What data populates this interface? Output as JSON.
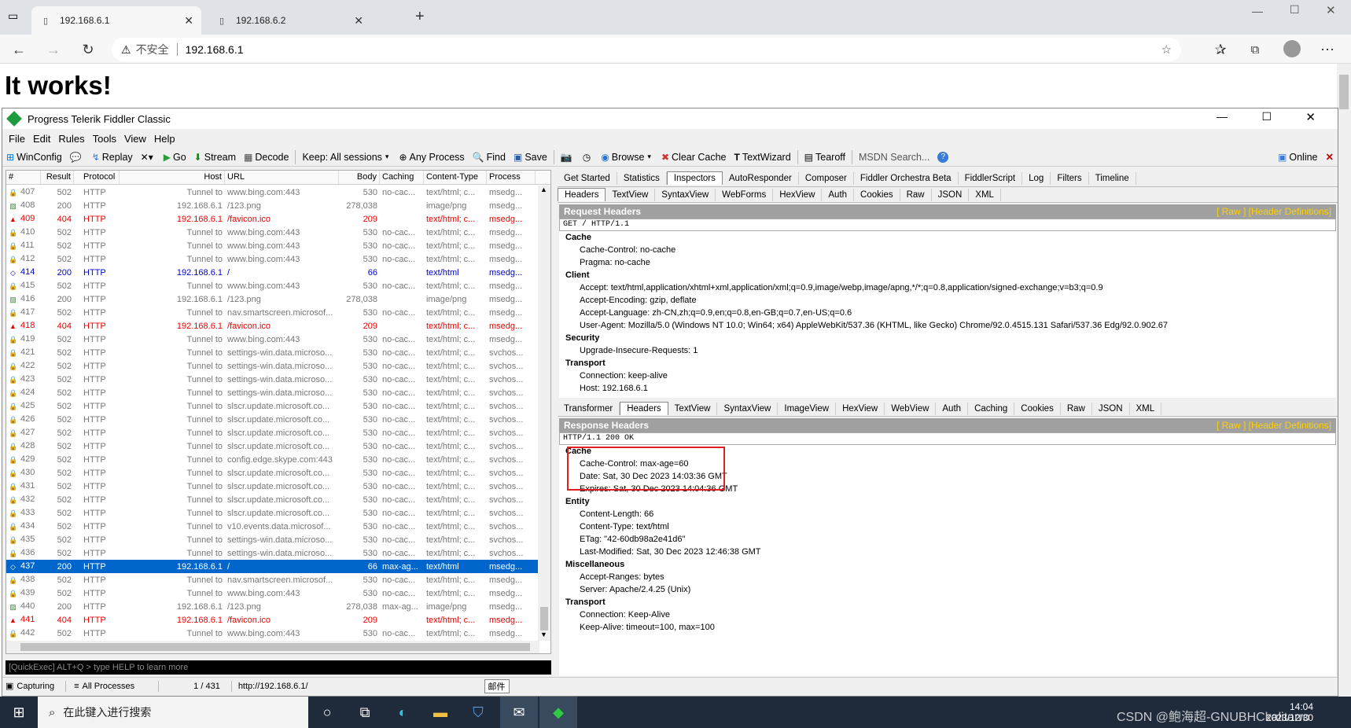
{
  "browser": {
    "tabs": [
      {
        "title": "192.168.6.1",
        "active": true
      },
      {
        "title": "192.168.6.2",
        "active": false
      }
    ],
    "security_label": "不安全",
    "url": "192.168.6.1",
    "page_heading": "It works!"
  },
  "fiddler": {
    "title": "Progress Telerik Fiddler Classic",
    "menu": [
      "File",
      "Edit",
      "Rules",
      "Tools",
      "View",
      "Help"
    ],
    "toolbar": {
      "winconfig": "WinConfig",
      "replay": "Replay",
      "go": "Go",
      "stream": "Stream",
      "decode": "Decode",
      "keep": "Keep: All sessions",
      "any_process": "Any Process",
      "find": "Find",
      "save": "Save",
      "browse": "Browse",
      "clear_cache": "Clear Cache",
      "textwizard": "TextWizard",
      "tearoff": "Tearoff",
      "msdn_search": "MSDN Search...",
      "online": "Online"
    },
    "session_columns": [
      "#",
      "Result",
      "Protocol",
      "Host",
      "URL",
      "Body",
      "Caching",
      "Content-Type",
      "Process"
    ],
    "sessions": [
      {
        "id": "407",
        "result": "502",
        "protocol": "HTTP",
        "host": "Tunnel to",
        "url": "www.bing.com:443",
        "body": "530",
        "caching": "no-cac...",
        "ctype": "text/html; c...",
        "process": "msedg...",
        "kind": "lock"
      },
      {
        "id": "408",
        "result": "200",
        "protocol": "HTTP",
        "host": "192.168.6.1",
        "url": "/123.png",
        "body": "278,038",
        "caching": "",
        "ctype": "image/png",
        "process": "msedg...",
        "kind": "img"
      },
      {
        "id": "409",
        "result": "404",
        "protocol": "HTTP",
        "host": "192.168.6.1",
        "url": "/favicon.ico",
        "body": "209",
        "caching": "",
        "ctype": "text/html; c...",
        "process": "msedg...",
        "kind": "err"
      },
      {
        "id": "410",
        "result": "502",
        "protocol": "HTTP",
        "host": "Tunnel to",
        "url": "www.bing.com:443",
        "body": "530",
        "caching": "no-cac...",
        "ctype": "text/html; c...",
        "process": "msedg...",
        "kind": "lock"
      },
      {
        "id": "411",
        "result": "502",
        "protocol": "HTTP",
        "host": "Tunnel to",
        "url": "www.bing.com:443",
        "body": "530",
        "caching": "no-cac...",
        "ctype": "text/html; c...",
        "process": "msedg...",
        "kind": "lock"
      },
      {
        "id": "412",
        "result": "502",
        "protocol": "HTTP",
        "host": "Tunnel to",
        "url": "www.bing.com:443",
        "body": "530",
        "caching": "no-cac...",
        "ctype": "text/html; c...",
        "process": "msedg...",
        "kind": "lock"
      },
      {
        "id": "414",
        "result": "200",
        "protocol": "HTTP",
        "host": "192.168.6.1",
        "url": "/",
        "body": "66",
        "caching": "",
        "ctype": "text/html",
        "process": "msedg...",
        "kind": "blue"
      },
      {
        "id": "415",
        "result": "502",
        "protocol": "HTTP",
        "host": "Tunnel to",
        "url": "www.bing.com:443",
        "body": "530",
        "caching": "no-cac...",
        "ctype": "text/html; c...",
        "process": "msedg...",
        "kind": "lock"
      },
      {
        "id": "416",
        "result": "200",
        "protocol": "HTTP",
        "host": "192.168.6.1",
        "url": "/123.png",
        "body": "278,038",
        "caching": "",
        "ctype": "image/png",
        "process": "msedg...",
        "kind": "img"
      },
      {
        "id": "417",
        "result": "502",
        "protocol": "HTTP",
        "host": "Tunnel to",
        "url": "nav.smartscreen.microsof...",
        "body": "530",
        "caching": "no-cac...",
        "ctype": "text/html; c...",
        "process": "msedg...",
        "kind": "lock"
      },
      {
        "id": "418",
        "result": "404",
        "protocol": "HTTP",
        "host": "192.168.6.1",
        "url": "/favicon.ico",
        "body": "209",
        "caching": "",
        "ctype": "text/html; c...",
        "process": "msedg...",
        "kind": "err"
      },
      {
        "id": "419",
        "result": "502",
        "protocol": "HTTP",
        "host": "Tunnel to",
        "url": "www.bing.com:443",
        "body": "530",
        "caching": "no-cac...",
        "ctype": "text/html; c...",
        "process": "msedg...",
        "kind": "lock"
      },
      {
        "id": "421",
        "result": "502",
        "protocol": "HTTP",
        "host": "Tunnel to",
        "url": "settings-win.data.microso...",
        "body": "530",
        "caching": "no-cac...",
        "ctype": "text/html; c...",
        "process": "svchos...",
        "kind": "lock"
      },
      {
        "id": "422",
        "result": "502",
        "protocol": "HTTP",
        "host": "Tunnel to",
        "url": "settings-win.data.microso...",
        "body": "530",
        "caching": "no-cac...",
        "ctype": "text/html; c...",
        "process": "svchos...",
        "kind": "lock"
      },
      {
        "id": "423",
        "result": "502",
        "protocol": "HTTP",
        "host": "Tunnel to",
        "url": "settings-win.data.microso...",
        "body": "530",
        "caching": "no-cac...",
        "ctype": "text/html; c...",
        "process": "svchos...",
        "kind": "lock"
      },
      {
        "id": "424",
        "result": "502",
        "protocol": "HTTP",
        "host": "Tunnel to",
        "url": "settings-win.data.microso...",
        "body": "530",
        "caching": "no-cac...",
        "ctype": "text/html; c...",
        "process": "svchos...",
        "kind": "lock"
      },
      {
        "id": "425",
        "result": "502",
        "protocol": "HTTP",
        "host": "Tunnel to",
        "url": "slscr.update.microsoft.co...",
        "body": "530",
        "caching": "no-cac...",
        "ctype": "text/html; c...",
        "process": "svchos...",
        "kind": "lock"
      },
      {
        "id": "426",
        "result": "502",
        "protocol": "HTTP",
        "host": "Tunnel to",
        "url": "slscr.update.microsoft.co...",
        "body": "530",
        "caching": "no-cac...",
        "ctype": "text/html; c...",
        "process": "svchos...",
        "kind": "lock"
      },
      {
        "id": "427",
        "result": "502",
        "protocol": "HTTP",
        "host": "Tunnel to",
        "url": "slscr.update.microsoft.co...",
        "body": "530",
        "caching": "no-cac...",
        "ctype": "text/html; c...",
        "process": "svchos...",
        "kind": "lock"
      },
      {
        "id": "428",
        "result": "502",
        "protocol": "HTTP",
        "host": "Tunnel to",
        "url": "slscr.update.microsoft.co...",
        "body": "530",
        "caching": "no-cac...",
        "ctype": "text/html; c...",
        "process": "svchos...",
        "kind": "lock"
      },
      {
        "id": "429",
        "result": "502",
        "protocol": "HTTP",
        "host": "Tunnel to",
        "url": "config.edge.skype.com:443",
        "body": "530",
        "caching": "no-cac...",
        "ctype": "text/html; c...",
        "process": "svchos...",
        "kind": "lock"
      },
      {
        "id": "430",
        "result": "502",
        "protocol": "HTTP",
        "host": "Tunnel to",
        "url": "slscr.update.microsoft.co...",
        "body": "530",
        "caching": "no-cac...",
        "ctype": "text/html; c...",
        "process": "svchos...",
        "kind": "lock"
      },
      {
        "id": "431",
        "result": "502",
        "protocol": "HTTP",
        "host": "Tunnel to",
        "url": "slscr.update.microsoft.co...",
        "body": "530",
        "caching": "no-cac...",
        "ctype": "text/html; c...",
        "process": "svchos...",
        "kind": "lock"
      },
      {
        "id": "432",
        "result": "502",
        "protocol": "HTTP",
        "host": "Tunnel to",
        "url": "slscr.update.microsoft.co...",
        "body": "530",
        "caching": "no-cac...",
        "ctype": "text/html; c...",
        "process": "svchos...",
        "kind": "lock"
      },
      {
        "id": "433",
        "result": "502",
        "protocol": "HTTP",
        "host": "Tunnel to",
        "url": "slscr.update.microsoft.co...",
        "body": "530",
        "caching": "no-cac...",
        "ctype": "text/html; c...",
        "process": "svchos...",
        "kind": "lock"
      },
      {
        "id": "434",
        "result": "502",
        "protocol": "HTTP",
        "host": "Tunnel to",
        "url": "v10.events.data.microsof...",
        "body": "530",
        "caching": "no-cac...",
        "ctype": "text/html; c...",
        "process": "svchos...",
        "kind": "lock"
      },
      {
        "id": "435",
        "result": "502",
        "protocol": "HTTP",
        "host": "Tunnel to",
        "url": "settings-win.data.microso...",
        "body": "530",
        "caching": "no-cac...",
        "ctype": "text/html; c...",
        "process": "svchos...",
        "kind": "lock"
      },
      {
        "id": "436",
        "result": "502",
        "protocol": "HTTP",
        "host": "Tunnel to",
        "url": "settings-win.data.microso...",
        "body": "530",
        "caching": "no-cac...",
        "ctype": "text/html; c...",
        "process": "svchos...",
        "kind": "lock"
      },
      {
        "id": "437",
        "result": "200",
        "protocol": "HTTP",
        "host": "192.168.6.1",
        "url": "/",
        "body": "66",
        "caching": "max-ag...",
        "ctype": "text/html",
        "process": "msedg...",
        "kind": "sel"
      },
      {
        "id": "438",
        "result": "502",
        "protocol": "HTTP",
        "host": "Tunnel to",
        "url": "nav.smartscreen.microsof...",
        "body": "530",
        "caching": "no-cac...",
        "ctype": "text/html; c...",
        "process": "msedg...",
        "kind": "lock"
      },
      {
        "id": "439",
        "result": "502",
        "protocol": "HTTP",
        "host": "Tunnel to",
        "url": "www.bing.com:443",
        "body": "530",
        "caching": "no-cac...",
        "ctype": "text/html; c...",
        "process": "msedg...",
        "kind": "lock"
      },
      {
        "id": "440",
        "result": "200",
        "protocol": "HTTP",
        "host": "192.168.6.1",
        "url": "/123.png",
        "body": "278,038",
        "caching": "max-ag...",
        "ctype": "image/png",
        "process": "msedg...",
        "kind": "img"
      },
      {
        "id": "441",
        "result": "404",
        "protocol": "HTTP",
        "host": "192.168.6.1",
        "url": "/favicon.ico",
        "body": "209",
        "caching": "",
        "ctype": "text/html; c...",
        "process": "msedg...",
        "kind": "err"
      },
      {
        "id": "442",
        "result": "502",
        "protocol": "HTTP",
        "host": "Tunnel to",
        "url": "www.bing.com:443",
        "body": "530",
        "caching": "no-cac...",
        "ctype": "text/html; c...",
        "process": "msedg...",
        "kind": "lock"
      }
    ],
    "quickexec": "[QuickExec] ALT+Q > type HELP to learn more",
    "status": {
      "capturing": "Capturing",
      "processes": "All Processes",
      "count": "1 / 431",
      "url": "http://192.168.6.1/",
      "tooltip": "邮件"
    },
    "top_tabs": [
      "Get Started",
      "Statistics",
      "Inspectors",
      "AutoResponder",
      "Composer",
      "Fiddler Orchestra Beta",
      "FiddlerScript",
      "Log",
      "Filters",
      "Timeline"
    ],
    "request_tabs": [
      "Headers",
      "TextView",
      "SyntaxView",
      "WebForms",
      "HexView",
      "Auth",
      "Cookies",
      "Raw",
      "JSON",
      "XML"
    ],
    "response_tabs": [
      "Transformer",
      "Headers",
      "TextView",
      "SyntaxView",
      "ImageView",
      "HexView",
      "WebView",
      "Auth",
      "Caching",
      "Cookies",
      "Raw",
      "JSON",
      "XML"
    ],
    "request": {
      "title": "Request Headers",
      "links": "[ Raw ]   [Header Definitions]",
      "line": "GET / HTTP/1.1",
      "groups": [
        {
          "name": "Cache",
          "lines": [
            "Cache-Control: no-cache",
            "Pragma: no-cache"
          ]
        },
        {
          "name": "Client",
          "lines": [
            "Accept: text/html,application/xhtml+xml,application/xml;q=0.9,image/webp,image/apng,*/*;q=0.8,application/signed-exchange;v=b3;q=0.9",
            "Accept-Encoding: gzip, deflate",
            "Accept-Language: zh-CN,zh;q=0.9,en;q=0.8,en-GB;q=0.7,en-US;q=0.6",
            "User-Agent: Mozilla/5.0 (Windows NT 10.0; Win64; x64) AppleWebKit/537.36 (KHTML, like Gecko) Chrome/92.0.4515.131 Safari/537.36 Edg/92.0.902.67"
          ]
        },
        {
          "name": "Security",
          "lines": [
            "Upgrade-Insecure-Requests: 1"
          ]
        },
        {
          "name": "Transport",
          "lines": [
            "Connection: keep-alive",
            "Host: 192.168.6.1"
          ]
        }
      ]
    },
    "response": {
      "title": "Response Headers",
      "links": "[ Raw ]   [Header Definitions]",
      "line": "HTTP/1.1 200 OK",
      "groups": [
        {
          "name": "Cache",
          "lines": [
            "Cache-Control: max-age=60",
            "Date: Sat, 30 Dec 2023 14:03:36 GMT",
            "Expires: Sat, 30 Dec 2023 14:04:36 GMT"
          ]
        },
        {
          "name": "Entity",
          "lines": [
            "Content-Length: 66",
            "Content-Type: text/html",
            "ETag: \"42-60db98a2e41d6\"",
            "Last-Modified: Sat, 30 Dec 2023 12:46:38 GMT"
          ]
        },
        {
          "name": "Miscellaneous",
          "lines": [
            "Accept-Ranges: bytes",
            "Server: Apache/2.4.25 (Unix)"
          ]
        },
        {
          "name": "Transport",
          "lines": [
            "Connection: Keep-Alive",
            "Keep-Alive: timeout=100, max=100"
          ]
        }
      ]
    }
  },
  "taskbar": {
    "search_placeholder": "在此键入进行搜索",
    "time": "14:04",
    "date": "2023/12/30",
    "watermark": "CSDN @鲍海超-GNUBHCkalitarro"
  },
  "colors": {
    "selected_row": "#0066cc",
    "error_text": "#e00000",
    "highlight_box": "#e02020",
    "header_bar": "#a0a0a0"
  }
}
